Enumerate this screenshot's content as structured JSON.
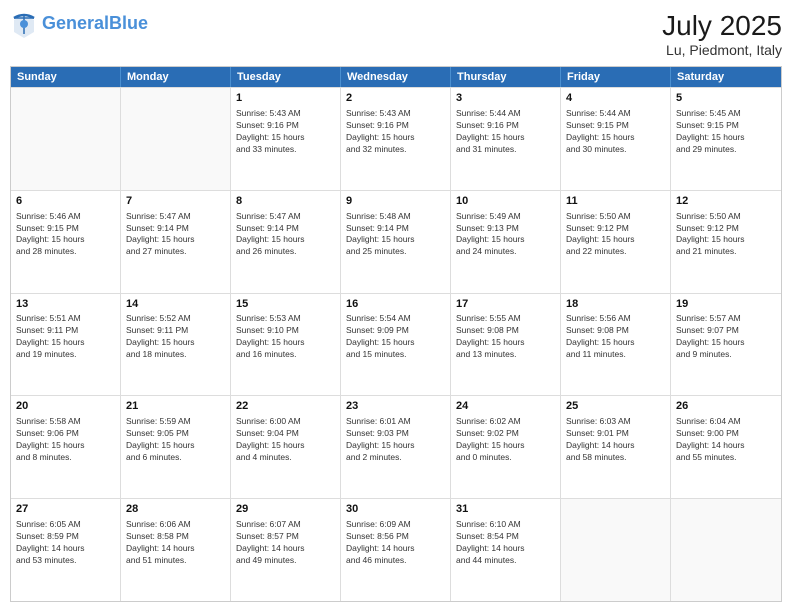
{
  "header": {
    "logo_line1": "General",
    "logo_line2": "Blue",
    "title": "July 2025",
    "subtitle": "Lu, Piedmont, Italy"
  },
  "days": [
    "Sunday",
    "Monday",
    "Tuesday",
    "Wednesday",
    "Thursday",
    "Friday",
    "Saturday"
  ],
  "weeks": [
    [
      {
        "day": "",
        "info": ""
      },
      {
        "day": "",
        "info": ""
      },
      {
        "day": "1",
        "info": "Sunrise: 5:43 AM\nSunset: 9:16 PM\nDaylight: 15 hours\nand 33 minutes."
      },
      {
        "day": "2",
        "info": "Sunrise: 5:43 AM\nSunset: 9:16 PM\nDaylight: 15 hours\nand 32 minutes."
      },
      {
        "day": "3",
        "info": "Sunrise: 5:44 AM\nSunset: 9:16 PM\nDaylight: 15 hours\nand 31 minutes."
      },
      {
        "day": "4",
        "info": "Sunrise: 5:44 AM\nSunset: 9:15 PM\nDaylight: 15 hours\nand 30 minutes."
      },
      {
        "day": "5",
        "info": "Sunrise: 5:45 AM\nSunset: 9:15 PM\nDaylight: 15 hours\nand 29 minutes."
      }
    ],
    [
      {
        "day": "6",
        "info": "Sunrise: 5:46 AM\nSunset: 9:15 PM\nDaylight: 15 hours\nand 28 minutes."
      },
      {
        "day": "7",
        "info": "Sunrise: 5:47 AM\nSunset: 9:14 PM\nDaylight: 15 hours\nand 27 minutes."
      },
      {
        "day": "8",
        "info": "Sunrise: 5:47 AM\nSunset: 9:14 PM\nDaylight: 15 hours\nand 26 minutes."
      },
      {
        "day": "9",
        "info": "Sunrise: 5:48 AM\nSunset: 9:14 PM\nDaylight: 15 hours\nand 25 minutes."
      },
      {
        "day": "10",
        "info": "Sunrise: 5:49 AM\nSunset: 9:13 PM\nDaylight: 15 hours\nand 24 minutes."
      },
      {
        "day": "11",
        "info": "Sunrise: 5:50 AM\nSunset: 9:12 PM\nDaylight: 15 hours\nand 22 minutes."
      },
      {
        "day": "12",
        "info": "Sunrise: 5:50 AM\nSunset: 9:12 PM\nDaylight: 15 hours\nand 21 minutes."
      }
    ],
    [
      {
        "day": "13",
        "info": "Sunrise: 5:51 AM\nSunset: 9:11 PM\nDaylight: 15 hours\nand 19 minutes."
      },
      {
        "day": "14",
        "info": "Sunrise: 5:52 AM\nSunset: 9:11 PM\nDaylight: 15 hours\nand 18 minutes."
      },
      {
        "day": "15",
        "info": "Sunrise: 5:53 AM\nSunset: 9:10 PM\nDaylight: 15 hours\nand 16 minutes."
      },
      {
        "day": "16",
        "info": "Sunrise: 5:54 AM\nSunset: 9:09 PM\nDaylight: 15 hours\nand 15 minutes."
      },
      {
        "day": "17",
        "info": "Sunrise: 5:55 AM\nSunset: 9:08 PM\nDaylight: 15 hours\nand 13 minutes."
      },
      {
        "day": "18",
        "info": "Sunrise: 5:56 AM\nSunset: 9:08 PM\nDaylight: 15 hours\nand 11 minutes."
      },
      {
        "day": "19",
        "info": "Sunrise: 5:57 AM\nSunset: 9:07 PM\nDaylight: 15 hours\nand 9 minutes."
      }
    ],
    [
      {
        "day": "20",
        "info": "Sunrise: 5:58 AM\nSunset: 9:06 PM\nDaylight: 15 hours\nand 8 minutes."
      },
      {
        "day": "21",
        "info": "Sunrise: 5:59 AM\nSunset: 9:05 PM\nDaylight: 15 hours\nand 6 minutes."
      },
      {
        "day": "22",
        "info": "Sunrise: 6:00 AM\nSunset: 9:04 PM\nDaylight: 15 hours\nand 4 minutes."
      },
      {
        "day": "23",
        "info": "Sunrise: 6:01 AM\nSunset: 9:03 PM\nDaylight: 15 hours\nand 2 minutes."
      },
      {
        "day": "24",
        "info": "Sunrise: 6:02 AM\nSunset: 9:02 PM\nDaylight: 15 hours\nand 0 minutes."
      },
      {
        "day": "25",
        "info": "Sunrise: 6:03 AM\nSunset: 9:01 PM\nDaylight: 14 hours\nand 58 minutes."
      },
      {
        "day": "26",
        "info": "Sunrise: 6:04 AM\nSunset: 9:00 PM\nDaylight: 14 hours\nand 55 minutes."
      }
    ],
    [
      {
        "day": "27",
        "info": "Sunrise: 6:05 AM\nSunset: 8:59 PM\nDaylight: 14 hours\nand 53 minutes."
      },
      {
        "day": "28",
        "info": "Sunrise: 6:06 AM\nSunset: 8:58 PM\nDaylight: 14 hours\nand 51 minutes."
      },
      {
        "day": "29",
        "info": "Sunrise: 6:07 AM\nSunset: 8:57 PM\nDaylight: 14 hours\nand 49 minutes."
      },
      {
        "day": "30",
        "info": "Sunrise: 6:09 AM\nSunset: 8:56 PM\nDaylight: 14 hours\nand 46 minutes."
      },
      {
        "day": "31",
        "info": "Sunrise: 6:10 AM\nSunset: 8:54 PM\nDaylight: 14 hours\nand 44 minutes."
      },
      {
        "day": "",
        "info": ""
      },
      {
        "day": "",
        "info": ""
      }
    ]
  ]
}
